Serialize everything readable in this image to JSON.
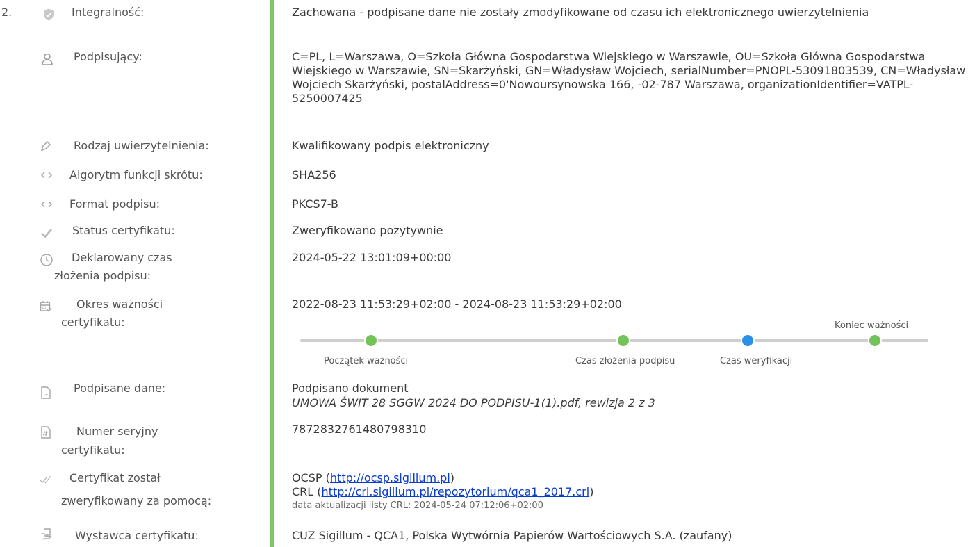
{
  "entry": {
    "index": "2.",
    "colors": {
      "accent": "#7dc56a",
      "dot_green": "#73c35a",
      "dot_blue": "#2a8fe6",
      "link": "#0a3ccf"
    },
    "rows": {
      "integrity": {
        "icon": "shield-check-icon",
        "label": "Integralność:",
        "value": "Zachowana - podpisane dane nie zostały zmodyfikowane od czasu ich elektronicznego uwierzytelnienia"
      },
      "signer": {
        "icon": "user-icon",
        "label": "Podpisujący:",
        "value": "C=PL, L=Warszawa, O=Szkoła Główna Gospodarstwa Wiejskiego w Warszawie, OU=Szkoła Główna Gospodarstwa Wiejskiego w Warszawie, SN=Skarżyński, GN=Władysław Wojciech, serialNumber=PNOPL-53091803539, CN=Władysław Wojciech Skarżyński, postalAddress=0'Nowoursynowska 166, -02-787 Warszawa, organizationIdentifier=VATPL-5250007425"
      },
      "auth_type": {
        "icon": "pen-icon",
        "label": "Rodzaj uwierzytelnienia:",
        "value": "Kwalifikowany podpis elektroniczny"
      },
      "hash_algo": {
        "icon": "code-icon",
        "label": "Algorytm funkcji skrótu:",
        "value": "SHA256"
      },
      "sig_format": {
        "icon": "code-icon",
        "label": "Format podpisu:",
        "value": "PKCS7-B"
      },
      "cert_status": {
        "icon": "checkmark-icon",
        "label": "Status certyfikatu:",
        "value": "Zweryfikowano pozytywnie"
      },
      "declared_time": {
        "icon": "clock-icon",
        "label_line1": "Deklarowany czas",
        "label_line2": "złożenia podpisu:",
        "value": "2024-05-22 13:01:09+00:00"
      },
      "validity": {
        "icon": "calendar-check-icon",
        "label_line1": "Okres ważności",
        "label_line2": "certyfikatu:",
        "value": "2022-08-23 11:53:29+02:00 - 2024-08-23 11:53:29+02:00",
        "timeline": {
          "start_label": "Początek ważności",
          "signing_label": "Czas złożenia podpisu",
          "verification_label": "Czas weryfikacji",
          "end_label": "Koniec ważności"
        }
      },
      "signed_data": {
        "icon": "signed-file-icon",
        "label": "Podpisane dane:",
        "value_line1": "Podpisano dokument",
        "value_line2": "UMOWA ŚWIT 28 SGGW 2024 DO PODPISU-1(1).pdf, rewizja 2 z 3"
      },
      "serial": {
        "icon": "hash-file-icon",
        "label_line1": "Numer seryjny",
        "label_line2": "certyfikatu:",
        "value": "7872832761480798310"
      },
      "verified_by": {
        "icon": "double-check-icon",
        "label_line1": "Certyfikat został",
        "label_line2": "zweryfikowany za pomocą:",
        "ocsp_prefix": "OCSP (",
        "ocsp_link": "http://ocsp.sigillum.pl",
        "ocsp_suffix": ")",
        "crl_prefix": "CRL (",
        "crl_link": "http://crl.sigillum.pl/repozytorium/qca1_2017.crl",
        "crl_suffix": ")",
        "crl_update": "data aktualizacji listy CRL: 2024-05-24 07:12:06+02:00"
      },
      "issuer": {
        "icon": "certificate-hand-icon",
        "label": "Wystawca certyfikatu:",
        "value": "CUZ Sigillum - QCA1, Polska Wytwórnia Papierów Wartościowych S.A. (zaufany)"
      }
    }
  }
}
